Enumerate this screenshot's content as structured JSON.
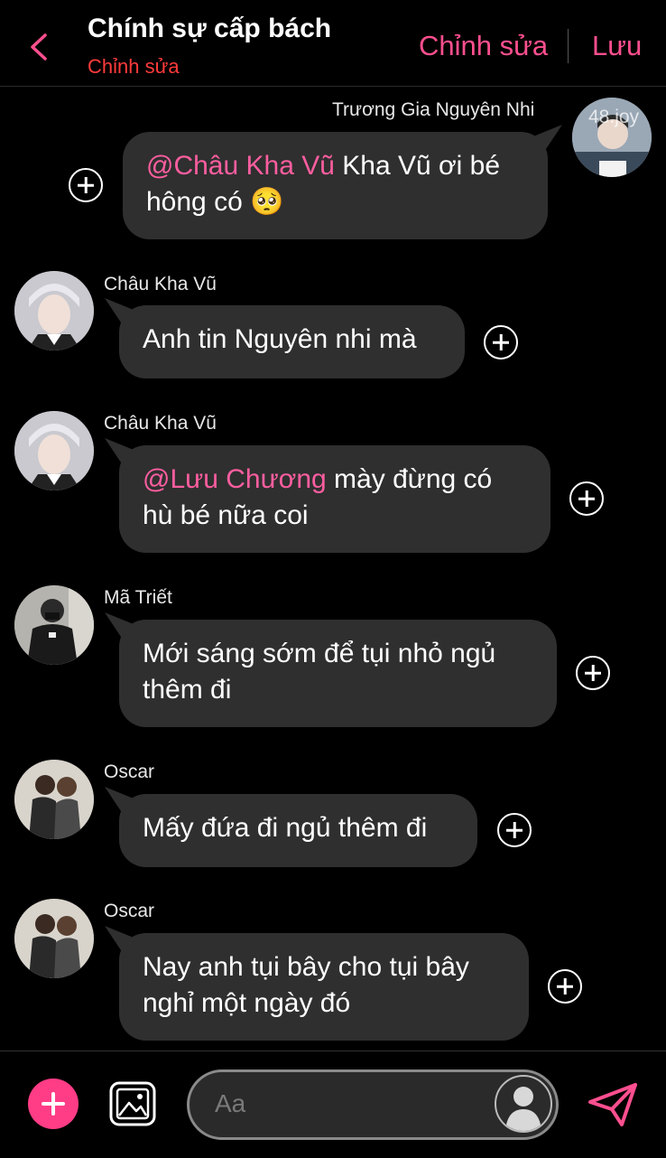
{
  "header": {
    "title": "Chính sự cấp bách",
    "subtitle": "Chỉnh sửa",
    "edit_label": "Chỉnh sửa",
    "save_label": "Lưu"
  },
  "messages": [
    {
      "sender": "Trương Gia Nguyên Nhi",
      "mention": "@Châu Kha Vũ",
      "line1_rest": " Kha Vũ ơi bé",
      "line2": "hông có 🥺",
      "avatar_watermark": "48.joy"
    },
    {
      "sender": "Châu Kha Vũ",
      "line1": "Anh tin Nguyên nhi mà"
    },
    {
      "sender": "Châu Kha Vũ",
      "mention": "@Lưu Chương",
      "line1_rest": "  mày đừng có",
      "line2": "hù bé nữa coi"
    },
    {
      "sender": "Mã Triết",
      "line1": "Mới sáng sớm để tụi nhỏ ngủ",
      "line2": "thêm đi"
    },
    {
      "sender": "Oscar",
      "line1": "Mấy đứa đi ngủ thêm đi"
    },
    {
      "sender": "Oscar",
      "line1": "Nay anh tụi bây cho tụi bây",
      "line2": "nghỉ một ngày đó"
    }
  ],
  "composer": {
    "placeholder": "Aa"
  },
  "colors": {
    "accent": "#ff4f8f",
    "mention": "#ff5ea0",
    "subtitle": "#ff3b3b",
    "bubble": "#2f2f2f",
    "fab": "#ff3c86"
  }
}
